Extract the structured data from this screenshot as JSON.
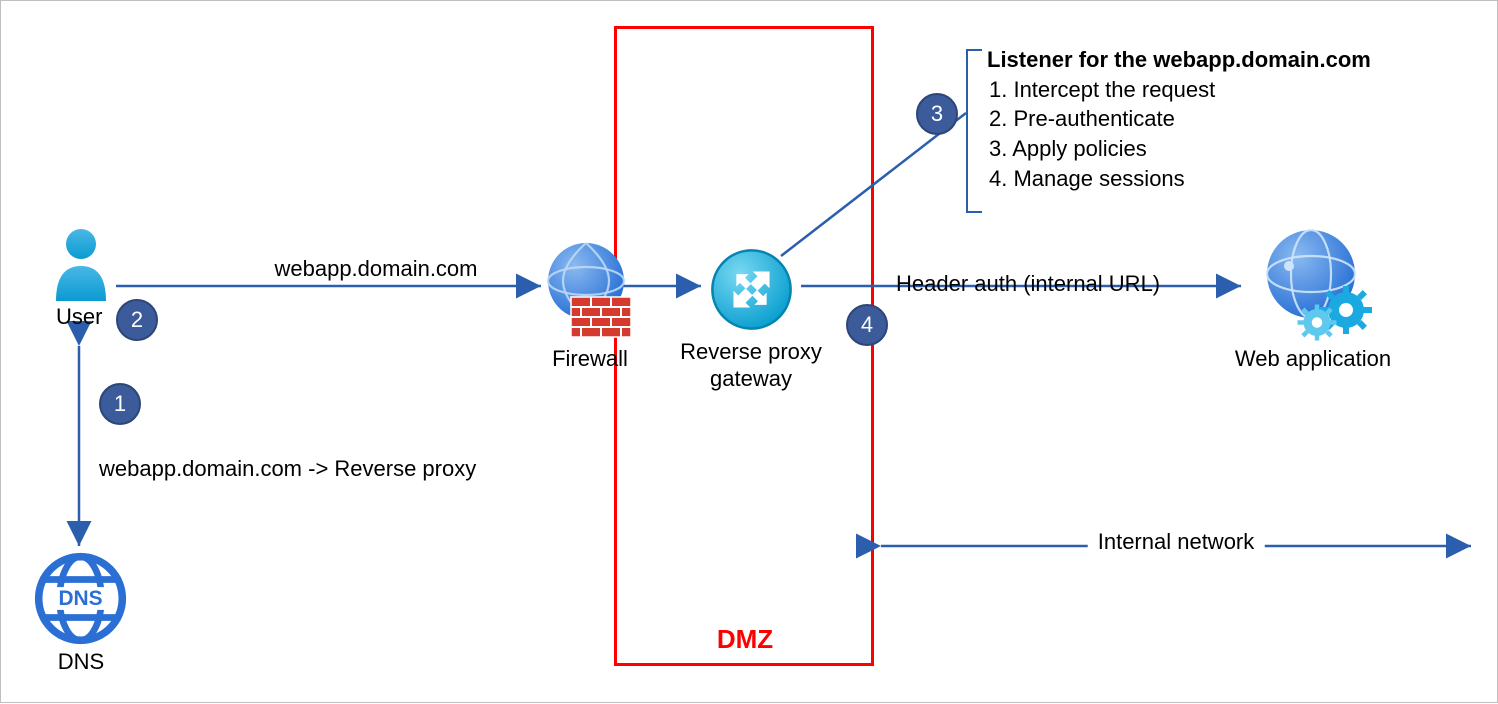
{
  "nodes": {
    "user": {
      "label": "User"
    },
    "dns": {
      "label": "DNS",
      "iconText": "DNS"
    },
    "firewall": {
      "label": "Firewall"
    },
    "reverseProxy": {
      "label": "Reverse proxy\ngateway"
    },
    "webApp": {
      "label": "Web application"
    }
  },
  "zones": {
    "dmz": {
      "label": "DMZ"
    },
    "internal": {
      "label": "Internal network"
    }
  },
  "edges": {
    "userToFirewall": {
      "label": "webapp.domain.com"
    },
    "dnsResolution": {
      "label": "webapp.domain.com -> Reverse proxy"
    },
    "proxyToApp": {
      "label": "Header auth (internal URL)"
    }
  },
  "steps": {
    "s1": "1",
    "s2": "2",
    "s3": "3",
    "s4": "4"
  },
  "listener": {
    "title": "Listener for the webapp.domain.com",
    "items": [
      "1. Intercept the request",
      "2. Pre-authenticate",
      "3. Apply policies",
      "4. Manage sessions"
    ]
  },
  "colors": {
    "accent": "#2b5fad",
    "badge": "#3b5b9a",
    "dmz": "#ff0000",
    "cyan": "#00b0e0",
    "brick": "#d63a2f"
  }
}
